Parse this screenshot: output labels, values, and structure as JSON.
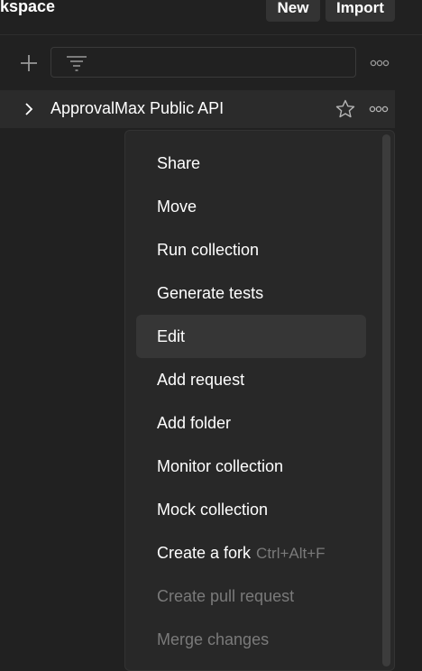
{
  "header": {
    "workspace_title": "kspace",
    "new_label": "New",
    "import_label": "Import"
  },
  "toolbar": {
    "plus_icon": "plus-icon",
    "filter_icon": "filter-icon",
    "more_icon": "more-horizontal-icon"
  },
  "collection": {
    "name": "ApprovalMax Public API",
    "chevron_icon": "chevron-right-icon",
    "star_icon": "star-icon",
    "more_icon": "more-horizontal-icon"
  },
  "menu": {
    "items": [
      {
        "label": "Share",
        "state": "enabled"
      },
      {
        "label": "Move",
        "state": "enabled"
      },
      {
        "label": "Run collection",
        "state": "enabled"
      },
      {
        "label": "Generate tests",
        "state": "enabled"
      },
      {
        "label": "Edit",
        "state": "hovered"
      },
      {
        "label": "Add request",
        "state": "enabled"
      },
      {
        "label": "Add folder",
        "state": "enabled"
      },
      {
        "label": "Monitor collection",
        "state": "enabled"
      },
      {
        "label": "Mock collection",
        "state": "enabled"
      },
      {
        "label": "Create a fork",
        "shortcut": "Ctrl+Alt+F",
        "state": "enabled"
      },
      {
        "label": "Create pull request",
        "state": "disabled"
      },
      {
        "label": "Merge changes",
        "state": "disabled"
      }
    ]
  },
  "colors": {
    "background": "#212121",
    "row_highlight": "#2b2b2b",
    "menu_bg": "#282828",
    "menu_hover": "#363636",
    "disabled_text": "#7a7a7a"
  }
}
